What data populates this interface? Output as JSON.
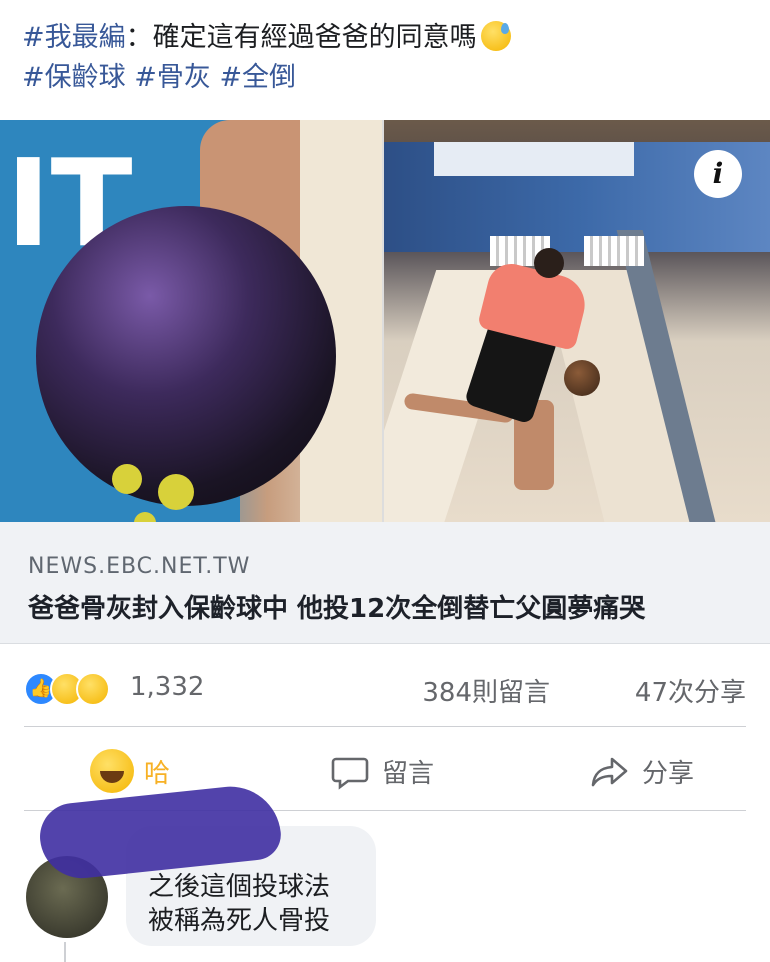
{
  "post": {
    "line1_tag": "#我最編",
    "line1_caption": "：確定這有經過爸爸的同意嗎",
    "tags": [
      "#保齡球",
      "#骨灰",
      "#全倒"
    ]
  },
  "link": {
    "domain": "NEWS.EBC.NET.TW",
    "headline": "爸爸骨灰封入保齡球中 他投12次全倒替亡父圓夢痛哭"
  },
  "stats": {
    "reactions": "1,332",
    "comments": "384則留言",
    "shares": "47次分享"
  },
  "actions": {
    "haha": "哈",
    "comment": "留言",
    "share": "分享"
  },
  "comment": {
    "text_line1": "之後這個投球法",
    "text_line2": "被稱為死人骨投"
  },
  "colors": {
    "hashtag": "#385898",
    "haha_active": "#f7b125",
    "like_blue": "#2d88ff",
    "muted": "#65676b"
  },
  "icons": {
    "info": "i",
    "like": "👍"
  }
}
